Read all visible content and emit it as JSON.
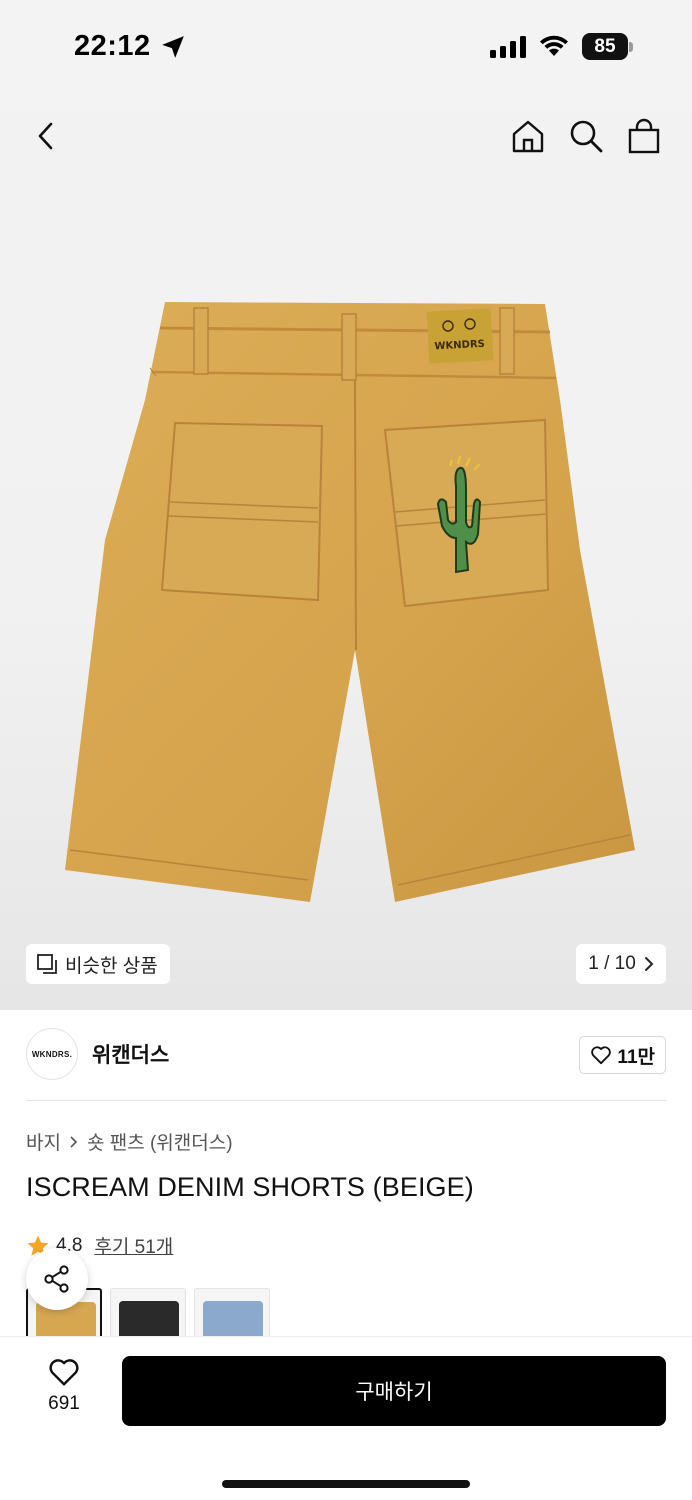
{
  "status_bar": {
    "time": "22:12",
    "battery": "85"
  },
  "nav": {
    "back_icon": "chevron-left-icon",
    "home_icon": "home-icon",
    "search_icon": "search-icon",
    "bag_icon": "shopping-bag-icon"
  },
  "hero": {
    "similar_label": "비슷한 상품",
    "counter": "1 / 10",
    "product_colors": {
      "denim": "#d9a94f",
      "patch": "#c9a236",
      "cactus": "#4f8f4a"
    },
    "patch_text": "WKNDRS"
  },
  "brand": {
    "logo_text": "WKNDRS.",
    "name": "위캔더스",
    "likes": "11만"
  },
  "breadcrumb": {
    "category": "바지",
    "subcategory": "숏 팬츠 (위캔더스)"
  },
  "product": {
    "title": "ISCREAM DENIM SHORTS (BEIGE)",
    "rating": "4.8",
    "reviews": "후기 51개"
  },
  "color_options": [
    {
      "name": "beige",
      "color": "#d6a651"
    },
    {
      "name": "black",
      "color": "#2a2a2a"
    },
    {
      "name": "blue",
      "color": "#8aa9cc"
    }
  ],
  "bottom": {
    "wish_count": "691",
    "buy_label": "구매하기"
  },
  "colors": {
    "accent": "#000000",
    "star": "#f5a623"
  }
}
